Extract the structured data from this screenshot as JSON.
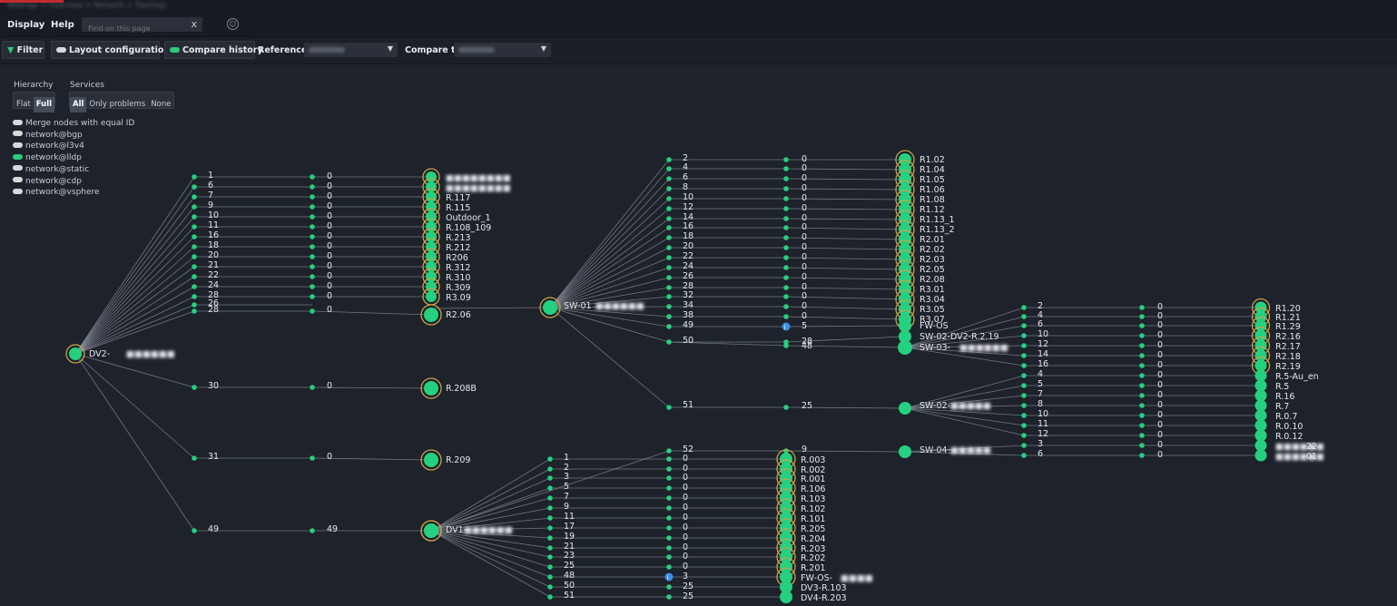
{
  "breadcrumb": "Netpage > Overview > Network > Topology",
  "menu": {
    "display": "Display",
    "help": "Help"
  },
  "search": {
    "placeholder": "Find on this page",
    "clear": "x"
  },
  "toolbar": {
    "filter": "Filter",
    "layout": "Layout configuration",
    "compare_history": "Compare history",
    "reference_label": "Reference",
    "compare_to_label": "Compare to"
  },
  "hierarchy": {
    "title": "Hierarchy",
    "flat": "Flat",
    "full": "Full"
  },
  "services": {
    "title": "Services",
    "all": "All",
    "only_problems": "Only problems",
    "none": "None"
  },
  "options": [
    {
      "label": "Merge nodes with equal ID",
      "on": false
    },
    {
      "label": "network@bgp",
      "on": false
    },
    {
      "label": "network@l3v4",
      "on": false
    },
    {
      "label": "network@lldp",
      "on": true
    },
    {
      "label": "network@static",
      "on": false
    },
    {
      "label": "network@cdp",
      "on": false
    },
    {
      "label": "network@vsphere",
      "on": false
    }
  ],
  "colors": {
    "node": "#25d07f",
    "ring": "#c9a24a",
    "edge": "#8c939f",
    "info": "#3b8fe8"
  },
  "graph": {
    "root": {
      "label": "DV2-"
    },
    "dv2_groups": [
      {
        "ports": [
          "1",
          "6",
          "7",
          "9",
          "10",
          "11",
          "16",
          "18",
          "20",
          "21",
          "22",
          "24",
          "28",
          "26"
        ],
        "mid": "0",
        "leaves": [
          "",
          "",
          "R.117",
          "R.115",
          "Outdoor_1",
          "R.108_109",
          "R.213",
          "R.212",
          "R206",
          "R.312",
          "R.310",
          "R.309",
          "R3.09"
        ],
        "ringed": true
      },
      {
        "ports": [
          "28"
        ],
        "mid": "0",
        "leaves": [
          "R2.06"
        ],
        "ringed": true
      },
      {
        "ports": [
          "30"
        ],
        "mid": "0",
        "leaves": [
          "R.208B"
        ],
        "ringed": true
      },
      {
        "ports": [
          "31"
        ],
        "mid": "0",
        "leaves": [
          "R.209"
        ],
        "ringed": true
      },
      {
        "ports": [
          "49"
        ],
        "mid": "49",
        "leaves": [
          "DV1-"
        ],
        "ringed": true
      }
    ],
    "sw01": {
      "label": "SW-01",
      "ports": [
        "2",
        "4",
        "6",
        "8",
        "10",
        "12",
        "14",
        "16",
        "18",
        "20",
        "22",
        "24",
        "26",
        "28",
        "32",
        "34",
        "38",
        "49",
        "50"
      ],
      "mids": [
        "0",
        "0",
        "0",
        "0",
        "0",
        "0",
        "0",
        "0",
        "0",
        "0",
        "0",
        "0",
        "0",
        "0",
        "0",
        "0",
        "0",
        "5",
        "28"
      ],
      "leaves": [
        "R1.02",
        "R1.04",
        "R1.05",
        "R1.06",
        "R1.08",
        "R1.12",
        "R1.13_1",
        "R1.13_2",
        "R2.01",
        "R2.02",
        "R2.03",
        "R2.05",
        "R2.08",
        "R3.01",
        "R3.04",
        "R3.05",
        "R3.07",
        "FW-OS",
        "SW-02-DV2-R.2.19"
      ],
      "extra_mid": "48",
      "extra_leaf": "SW-03-"
    },
    "sw02": {
      "port": "51",
      "mid": "25",
      "label": "SW-02-"
    },
    "sw04": {
      "port": "52",
      "mid": "9",
      "label": "SW-04-"
    },
    "sw02_leaves": {
      "ports": [
        "2",
        "4",
        "6",
        "10",
        "12",
        "14",
        "16",
        "4",
        "5",
        "7",
        "8",
        "10",
        "11",
        "12",
        "3",
        "6"
      ],
      "mids": [
        "0",
        "0",
        "0",
        "0",
        "0",
        "0",
        "0",
        "0",
        "0",
        "0",
        "0",
        "0",
        "0",
        "0",
        "0",
        "0"
      ],
      "leaves": [
        "R1.20",
        "R1.21",
        "R1.29",
        "R2.16",
        "R2.17",
        "R2.18",
        "R2.19",
        "R.5-Au_en",
        "R.5",
        "R.16",
        "R.7",
        "R.0.7",
        "R.0.10",
        "R.0.12",
        "22",
        "01"
      ]
    },
    "dv1": {
      "ports": [
        "1",
        "2",
        "3",
        "5",
        "7",
        "9",
        "11",
        "17",
        "19",
        "21",
        "23",
        "25",
        "48",
        "50",
        "51"
      ],
      "mids": [
        "0",
        "0",
        "0",
        "0",
        "0",
        "0",
        "0",
        "0",
        "0",
        "0",
        "0",
        "0",
        "3",
        "25",
        "25"
      ],
      "leaves": [
        "R.003",
        "R.002",
        "R.001",
        "R.106",
        "R.103",
        "R.102",
        "R.101",
        "R.205",
        "R.204",
        "R.203",
        "R.202",
        "R.201",
        "FW-OS-",
        "DV3-R.103",
        "DV4-R.203"
      ]
    }
  }
}
